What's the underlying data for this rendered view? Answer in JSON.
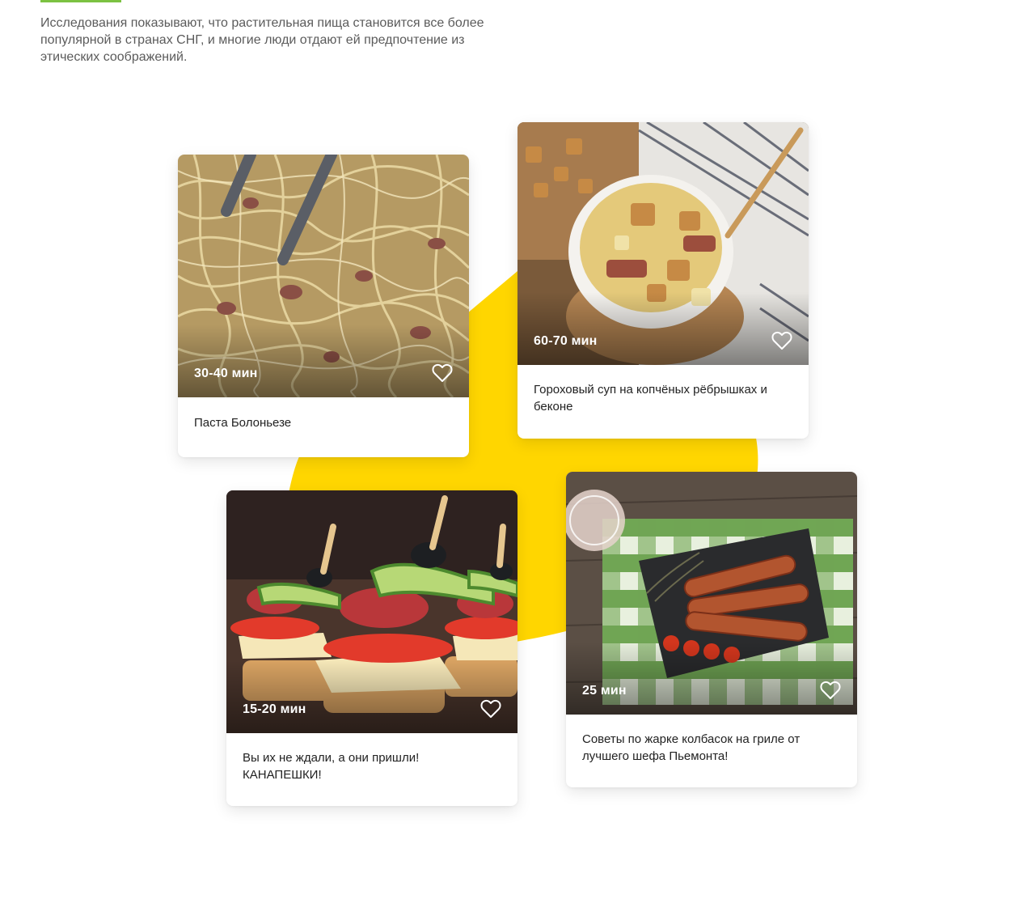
{
  "intro": {
    "text": "Исследования показывают, что растительная пища становится все более популярной в странах СНГ, и многие люди отдают ей предпочтение из этических соображений."
  },
  "colors": {
    "accent": "#7cc242",
    "blob": "#ffd600",
    "text": "#1f1f1f",
    "muted": "#5b5b5b"
  },
  "recipes": [
    {
      "time": "30-40 мин",
      "title": "Паста Болоньезе",
      "icon": "heart-icon"
    },
    {
      "time": "60-70 мин",
      "title": "Гороховый суп на копчёных рёбрышках и беконе",
      "icon": "heart-icon"
    },
    {
      "time": "15-20 мин",
      "title": "Вы их не ждали, а они пришли! КАНАПЕШКИ!",
      "icon": "heart-icon"
    },
    {
      "time": "25 мин",
      "title": "Советы по жарке колбасок на гриле от лучшего шефа Пьемонта!",
      "icon": "heart-icon"
    }
  ]
}
